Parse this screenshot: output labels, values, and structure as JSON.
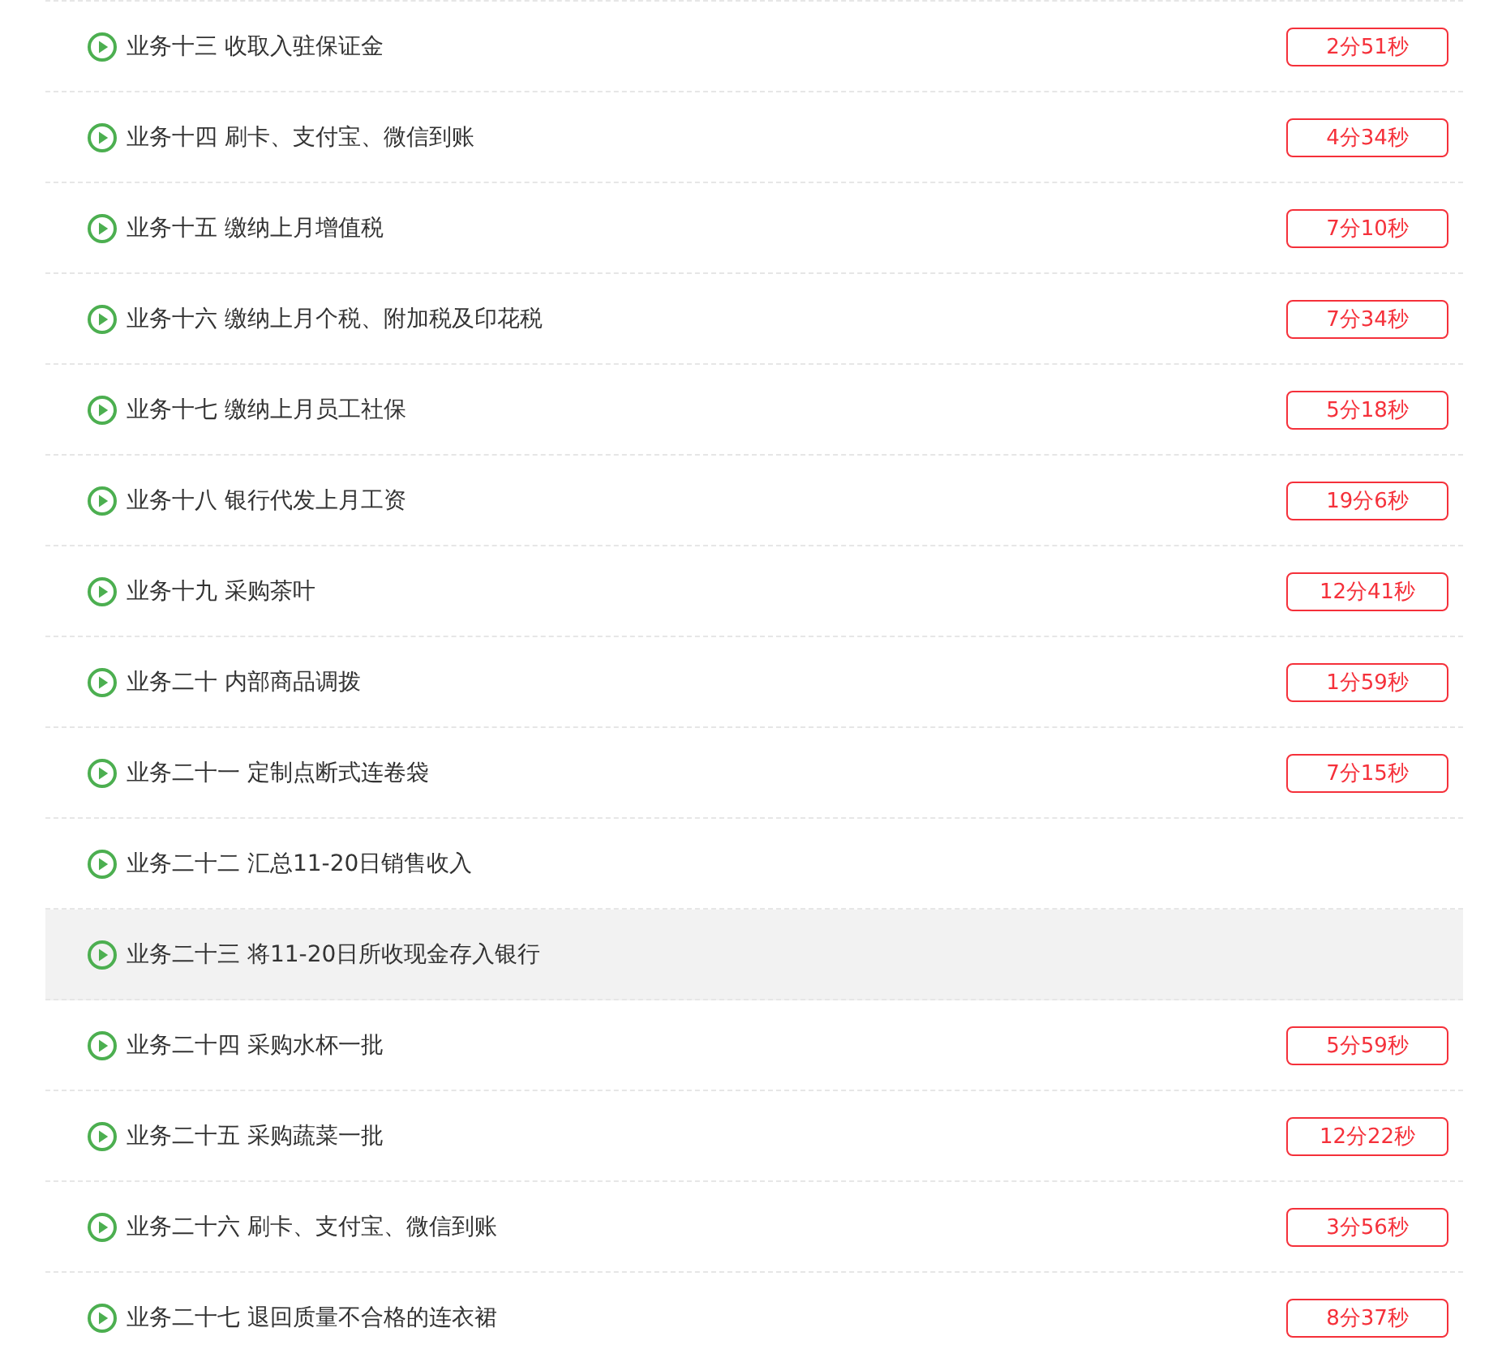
{
  "lessons": [
    {
      "title": "业务十三 收取入驻保证金",
      "duration": "2分51秒",
      "selected": false
    },
    {
      "title": "业务十四 刷卡、支付宝、微信到账",
      "duration": "4分34秒",
      "selected": false
    },
    {
      "title": "业务十五 缴纳上月增值税",
      "duration": "7分10秒",
      "selected": false
    },
    {
      "title": "业务十六 缴纳上月个税、附加税及印花税",
      "duration": "7分34秒",
      "selected": false
    },
    {
      "title": "业务十七 缴纳上月员工社保",
      "duration": "5分18秒",
      "selected": false
    },
    {
      "title": "业务十八 银行代发上月工资",
      "duration": "19分6秒",
      "selected": false
    },
    {
      "title": "业务十九 采购茶叶",
      "duration": "12分41秒",
      "selected": false
    },
    {
      "title": "业务二十 内部商品调拨",
      "duration": "1分59秒",
      "selected": false
    },
    {
      "title": "业务二十一 定制点断式连卷袋",
      "duration": "7分15秒",
      "selected": false
    },
    {
      "title": "业务二十二 汇总11-20日销售收入",
      "selected": false
    },
    {
      "title": "业务二十三 将11-20日所收现金存入银行",
      "selected": true
    },
    {
      "title": "业务二十四 采购水杯一批",
      "duration": "5分59秒",
      "selected": false
    },
    {
      "title": "业务二十五 采购蔬菜一批",
      "duration": "12分22秒",
      "selected": false
    },
    {
      "title": "业务二十六 刷卡、支付宝、微信到账",
      "duration": "3分56秒",
      "selected": false
    },
    {
      "title": "业务二十七 退回质量不合格的连衣裙",
      "duration": "8分37秒",
      "selected": false
    }
  ]
}
